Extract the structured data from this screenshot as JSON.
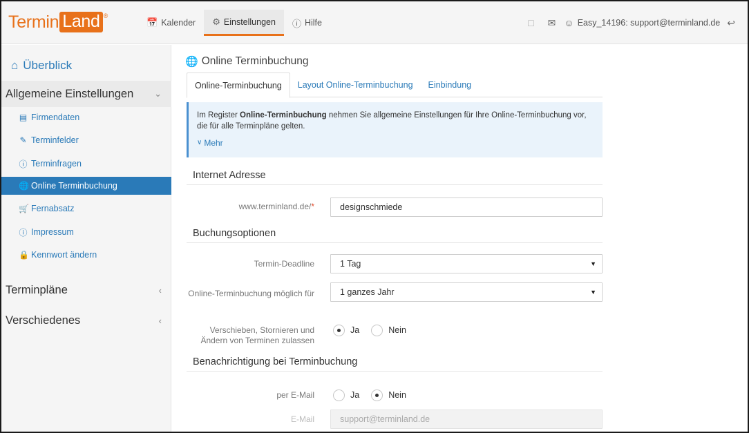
{
  "header": {
    "logo_part1": "Termin",
    "logo_part2": "Land",
    "logo_reg": "®",
    "nav": [
      {
        "label": "Kalender",
        "icon": "calendar-icon"
      },
      {
        "label": "Einstellungen",
        "icon": "gear-icon",
        "active": true
      },
      {
        "label": "Hilfe",
        "icon": "help-icon"
      }
    ],
    "user_label": "Easy_14196: support@terminland.de"
  },
  "sidebar": {
    "overview": "Überblick",
    "sections": [
      {
        "label": "Allgemeine Einstellungen",
        "open": true
      },
      {
        "label": "Terminpläne",
        "open": false
      },
      {
        "label": "Verschiedenes",
        "open": false
      }
    ],
    "items": [
      {
        "label": "Firmendaten",
        "icon": "id-card-icon"
      },
      {
        "label": "Terminfelder",
        "icon": "edit-icon"
      },
      {
        "label": "Terminfragen",
        "icon": "question-icon"
      },
      {
        "label": "Online Terminbuchung",
        "icon": "globe-icon",
        "active": true
      },
      {
        "label": "Fernabsatz",
        "icon": "cart-icon"
      },
      {
        "label": "Impressum",
        "icon": "info-icon"
      },
      {
        "label": "Kennwort ändern",
        "icon": "lock-icon"
      }
    ]
  },
  "main": {
    "title": "Online Terminbuchung",
    "tabs": [
      {
        "label": "Online-Terminbuchung",
        "active": true
      },
      {
        "label": "Layout Online-Terminbuchung"
      },
      {
        "label": "Einbindung"
      }
    ],
    "info": {
      "text_before": "Im Register ",
      "text_bold": "Online-Terminbuchung",
      "text_after": " nehmen Sie allgemeine Einstellungen für Ihre Online-Terminbuchung vor, die für alle Terminpläne gelten.",
      "more": "Mehr"
    },
    "sections": {
      "internet": "Internet Adresse",
      "booking": "Buchungsoptionen",
      "notify": "Benachrichtigung bei Terminbuchung"
    },
    "url_label": "www.terminland.de/",
    "url_required": "*",
    "url_value": "designschmiede",
    "deadline_label": "Termin-Deadline",
    "deadline_value": "1 Tag",
    "possible_label": "Online-Terminbuchung möglich für",
    "possible_value": "1 ganzes Jahr",
    "reschedule_label": "Verschieben, Stornieren und Ändern von Terminen zulassen",
    "reschedule_yes": "Ja",
    "reschedule_no": "Nein",
    "reschedule_selected": "Ja",
    "email_notify_label": "per E-Mail",
    "email_notify_yes": "Ja",
    "email_notify_no": "Nein",
    "email_notify_selected": "Nein",
    "email_label": "E-Mail",
    "email_value": "support@terminland.de"
  },
  "colors": {
    "brand_orange": "#e8711a",
    "link_blue": "#2a7ab8",
    "info_bg": "#eaf3fb"
  }
}
